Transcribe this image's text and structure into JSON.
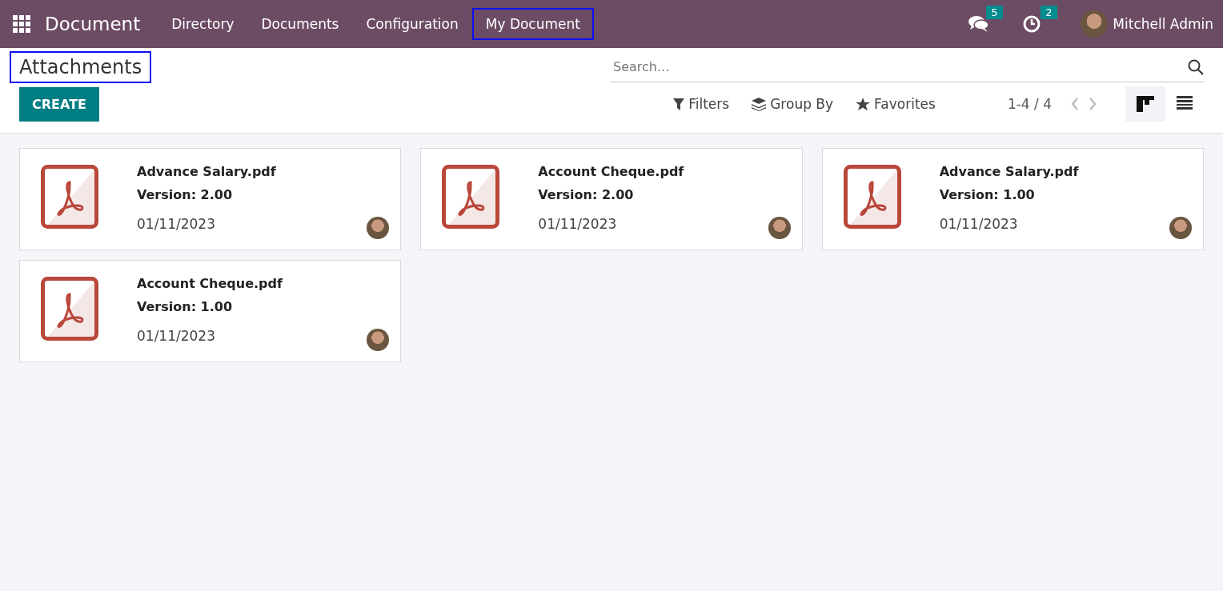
{
  "navbar": {
    "app_name": "Document",
    "menu": [
      {
        "label": "Directory",
        "highlighted": false
      },
      {
        "label": "Documents",
        "highlighted": false
      },
      {
        "label": "Configuration",
        "highlighted": false
      },
      {
        "label": "My Document",
        "highlighted": true
      }
    ],
    "messages_count": "5",
    "activities_count": "2",
    "user": "Mitchell Admin"
  },
  "control_panel": {
    "title": "Attachments",
    "title_highlighted": true,
    "create_button": "CREATE",
    "search": {
      "placeholder": "Search..."
    },
    "filters": [
      {
        "kind": "filter",
        "label": "Filters"
      },
      {
        "kind": "group",
        "label": "Group By"
      },
      {
        "kind": "favorite",
        "label": "Favorites"
      }
    ],
    "pager": "1-4 / 4",
    "views": [
      {
        "kind": "kanban",
        "selected": true
      },
      {
        "kind": "list",
        "selected": false
      }
    ]
  },
  "cards": [
    {
      "name": "Advance Salary.pdf",
      "version": "Version: 2.00",
      "date": "01/11/2023"
    },
    {
      "name": "Account Cheque.pdf",
      "version": "Version: 2.00",
      "date": "01/11/2023"
    },
    {
      "name": "Advance Salary.pdf",
      "version": "Version: 1.00",
      "date": "01/11/2023"
    },
    {
      "name": "Account Cheque.pdf",
      "version": "Version: 1.00",
      "date": "01/11/2023"
    }
  ]
}
